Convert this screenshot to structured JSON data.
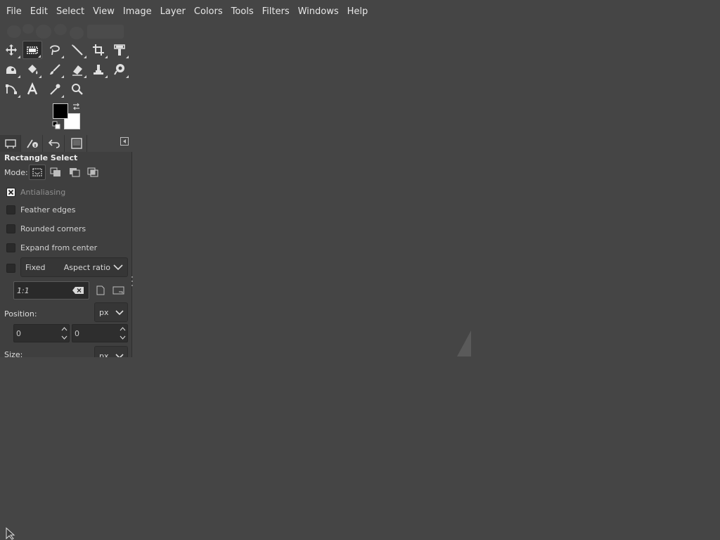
{
  "menubar": {
    "items": [
      "File",
      "Edit",
      "Select",
      "View",
      "Image",
      "Layer",
      "Colors",
      "Tools",
      "Filters",
      "Windows",
      "Help"
    ]
  },
  "toolbox": {
    "rows": [
      [
        "move-tool-icon",
        "rectangle-select-tool-icon",
        "free-select-tool-icon",
        "fuzzy-select-tool-icon",
        "crop-tool-icon",
        "unified-transform-tool-icon"
      ],
      [
        "warp-transform-tool-icon",
        "bucket-fill-tool-icon",
        "paintbrush-tool-icon",
        "eraser-tool-icon",
        "clone-tool-icon",
        "smudge-tool-icon"
      ],
      [
        "paths-tool-icon",
        "text-tool-icon",
        "color-picker-tool-icon",
        "zoom-tool-icon"
      ]
    ],
    "active_tool": "rectangle-select-tool-icon",
    "foreground_color": "#000000",
    "background_color": "#ffffff"
  },
  "dock": {
    "tabs": [
      "tool-options-tab-icon",
      "device-status-tab-icon",
      "undo-history-tab-icon",
      "images-tab-icon"
    ]
  },
  "tool_options": {
    "title": "Rectangle Select",
    "mode_label": "Mode:",
    "checkboxes": [
      {
        "label": "Antialiasing",
        "checked": true,
        "enabled": false
      },
      {
        "label": "Feather edges",
        "checked": false,
        "enabled": true
      },
      {
        "label": "Rounded corners",
        "checked": false,
        "enabled": true
      },
      {
        "label": "Expand from center",
        "checked": false,
        "enabled": true
      }
    ],
    "fixed": {
      "checked": false,
      "label": "Fixed",
      "selected": "Aspect ratio",
      "ratio_value": "1:1"
    },
    "position": {
      "label": "Position:",
      "unit": "px",
      "x": "0",
      "y": "0"
    },
    "size": {
      "label": "Size:",
      "unit": "px"
    }
  },
  "colors": {
    "background": "#454545",
    "panel": "#3f3f3f",
    "text": "#dcdcdc"
  }
}
